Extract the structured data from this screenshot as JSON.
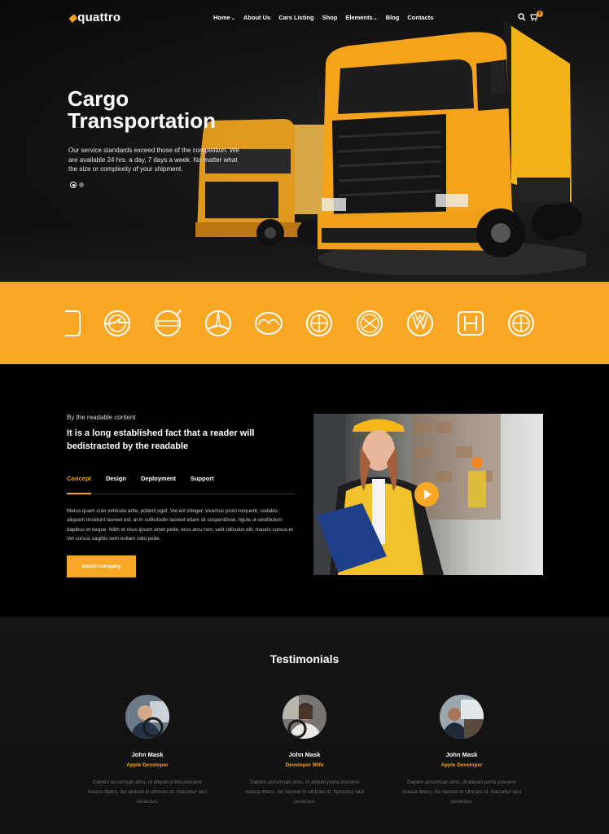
{
  "header": {
    "logo": "quattro",
    "menu": [
      {
        "label": "Home",
        "dropdown": true
      },
      {
        "label": "About Us",
        "dropdown": false
      },
      {
        "label": "Cars Listing",
        "dropdown": false
      },
      {
        "label": "Shop",
        "dropdown": false
      },
      {
        "label": "Elements",
        "dropdown": true
      },
      {
        "label": "Blog",
        "dropdown": false
      },
      {
        "label": "Contacts",
        "dropdown": false
      }
    ],
    "cart_count": "0",
    "icons": [
      "search-icon",
      "cart-icon"
    ]
  },
  "hero": {
    "title": "Cargo Transportation",
    "text": "Our service standards exceed those of the competition. We are available 24 hrs. a day, 7 days a week. No matter what the size or complexity of your shipment.",
    "slides": 2,
    "active_slide": 1
  },
  "brands": [
    "partial-logo-icon",
    "opel-logo-icon",
    "volvo-logo-icon",
    "mercedes-logo-icon",
    "mazda-logo-icon",
    "bmw-logo-icon",
    "alfa-logo-icon",
    "volkswagen-logo-icon",
    "honda-logo-icon",
    "bmw-logo-icon"
  ],
  "about": {
    "eyebrow": "By the readable content",
    "title": "It is a long established fact that a reader will bedistracted by the readable",
    "tabs": [
      "Concept",
      "Design",
      "Deployment",
      "Support"
    ],
    "active_tab": "Concept",
    "text": "Metus quam cras vehicula ante, potenti eget. Vel est integer, vivamus proin torquent, sodales aliquam tincidunt laoreet est, at in sollicitudin laoreet etiam sit suspendisse, ligula ut vestibulum dapibus et neque. Nibh et risus ipsum amet pede, eros arcu non, velit ridiculus elit, mauris cursus et. Vel cursus sagittis sem nullam odio pede.",
    "button": "about company",
    "accent": "#f9a825"
  },
  "testimonials": {
    "title": "Testimonials",
    "items": [
      {
        "name": "John Mask",
        "role": "Apple Developer",
        "quote": "Dapien accumsan arcu, id aliquet porta posuere massa libero, dui laoreet in ultricies id. Nascetur wisi senectus."
      },
      {
        "name": "John Mask",
        "role": "Developer Wife",
        "quote": "Dapien accumsan arcu, id aliquet porta posuere massa libero, dui laoreet in ultricies id. Nascetur wisi senectus."
      },
      {
        "name": "John Mask",
        "role": "Apple Developer",
        "quote": "Dapien accumsan arcu, id aliquet porta posuere massa libero, dui laoreet in ultricies id. Nascetur wisi senectus."
      }
    ]
  }
}
